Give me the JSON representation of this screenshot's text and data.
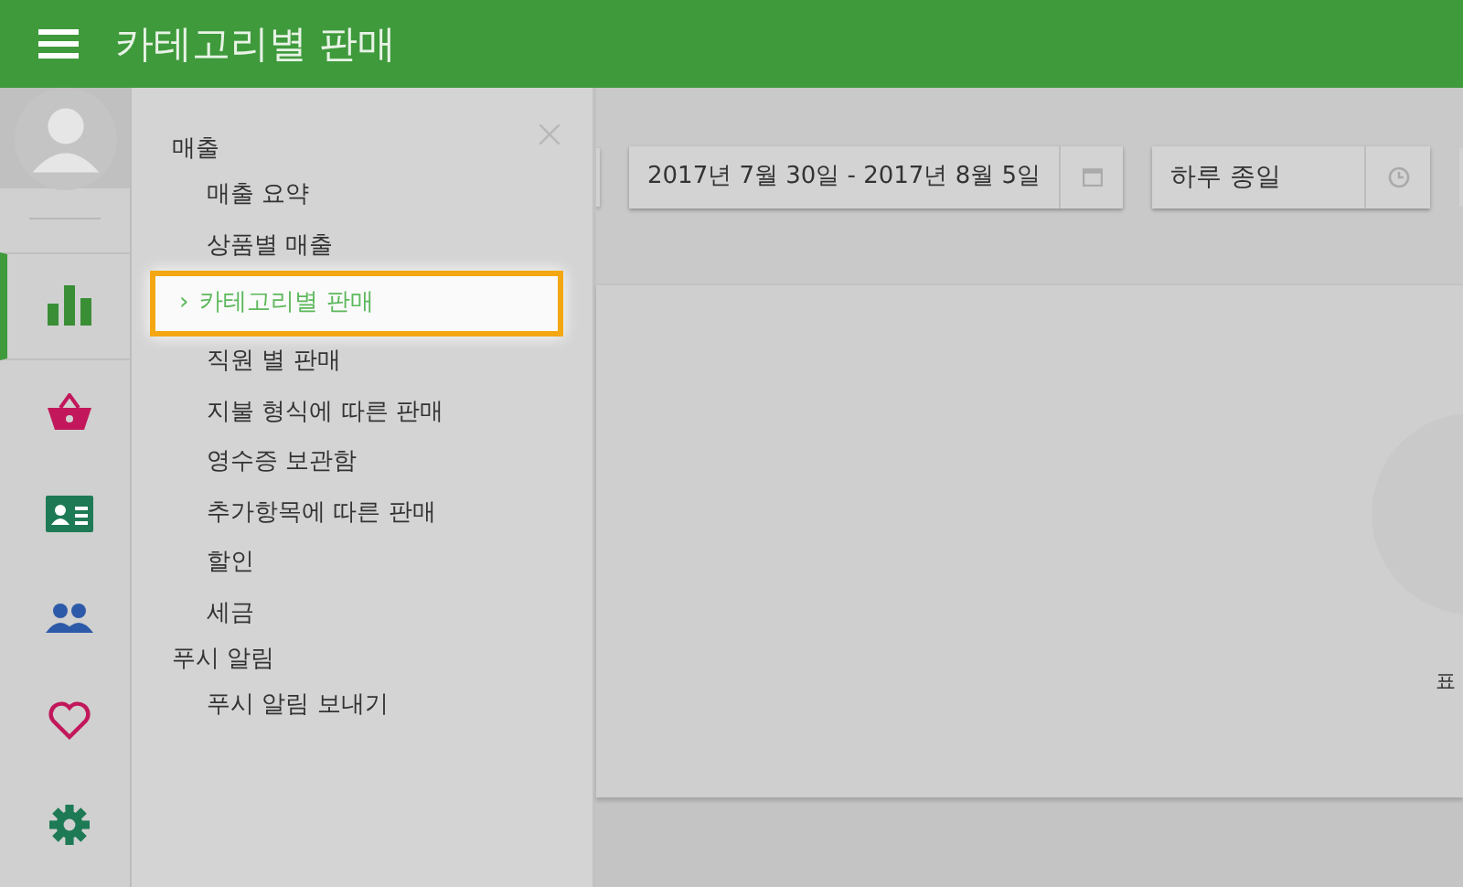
{
  "header": {
    "title": "카테고리별 판매"
  },
  "rail": [
    {
      "kind": "chart",
      "selected": true
    },
    {
      "kind": "basket",
      "selected": false
    },
    {
      "kind": "card",
      "selected": false
    },
    {
      "kind": "people",
      "selected": false
    },
    {
      "kind": "heart",
      "selected": false
    },
    {
      "kind": "gear",
      "selected": false
    }
  ],
  "menu": [
    {
      "label": "매출",
      "children": [
        {
          "label": "매출 요약",
          "selected": false
        },
        {
          "label": "상품별 매출",
          "selected": false
        },
        {
          "label": "카테고리별 판매",
          "selected": true
        },
        {
          "label": "직원 별 판매",
          "selected": false
        },
        {
          "label": "지불 형식에 따른 판매",
          "selected": false
        },
        {
          "label": "영수증 보관함",
          "selected": false
        },
        {
          "label": "추가항목에 따른 판매",
          "selected": false
        },
        {
          "label": "할인",
          "selected": false
        },
        {
          "label": "세금",
          "selected": false
        }
      ]
    },
    {
      "label": "푸시 알림",
      "children": [
        {
          "label": "푸시 알림 보내기",
          "selected": false
        }
      ]
    }
  ],
  "selected_marker": "›",
  "date_range": {
    "value": "2017년 7월 30일 - 2017년 8월 5일"
  },
  "time_range": {
    "value": "하루 종일"
  },
  "chart_label": "표"
}
